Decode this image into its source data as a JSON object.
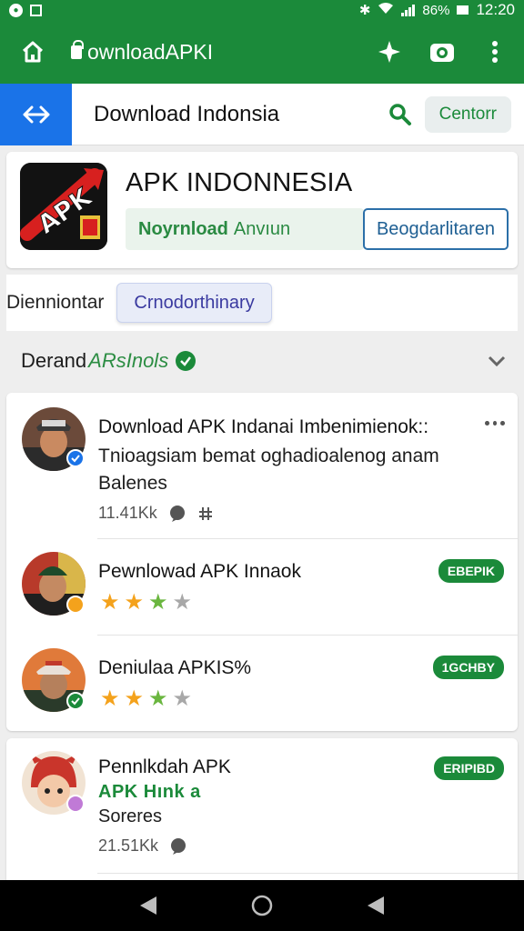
{
  "status_bar": {
    "battery": "86%",
    "time": "12:20"
  },
  "app_bar": {
    "title": "ownloadAPKI"
  },
  "search": {
    "query": "Download Indonsia",
    "center_label": "Centorr"
  },
  "app_card": {
    "name": "APK INDONNESIA",
    "icon_text": "APK",
    "download_bold": "Noyrnload",
    "download_rest": "Anvıun",
    "register_label": "Beogdarlitaren"
  },
  "tabs": {
    "plain": "Dienniontar",
    "active": "Crnodorthinary"
  },
  "section": {
    "prefix": "Derand",
    "green": "ARsInols"
  },
  "items": [
    {
      "title": "Download APK Indanai Imbenimienok::",
      "subtitle": "Tnioagsiam bemat oghadioalenog anam",
      "subtitle2": "Balenes",
      "meta": "11.41Kk"
    },
    {
      "title": "Pewnlowad APK Innaok",
      "badge": "EBEPIK",
      "rating": 3
    },
    {
      "title": "Deniulaa APKIS%",
      "badge": "1GCHBY",
      "rating": 3
    },
    {
      "title": "Pennlkdah APK",
      "green": "APK Hınk a",
      "subtitle": "Soreres",
      "meta": "21.51Kk",
      "badge": "ERIPIBD"
    }
  ],
  "colors": {
    "primary_green": "#1b8a3a",
    "blue": "#1a73e8",
    "star": "#f4a21c"
  }
}
